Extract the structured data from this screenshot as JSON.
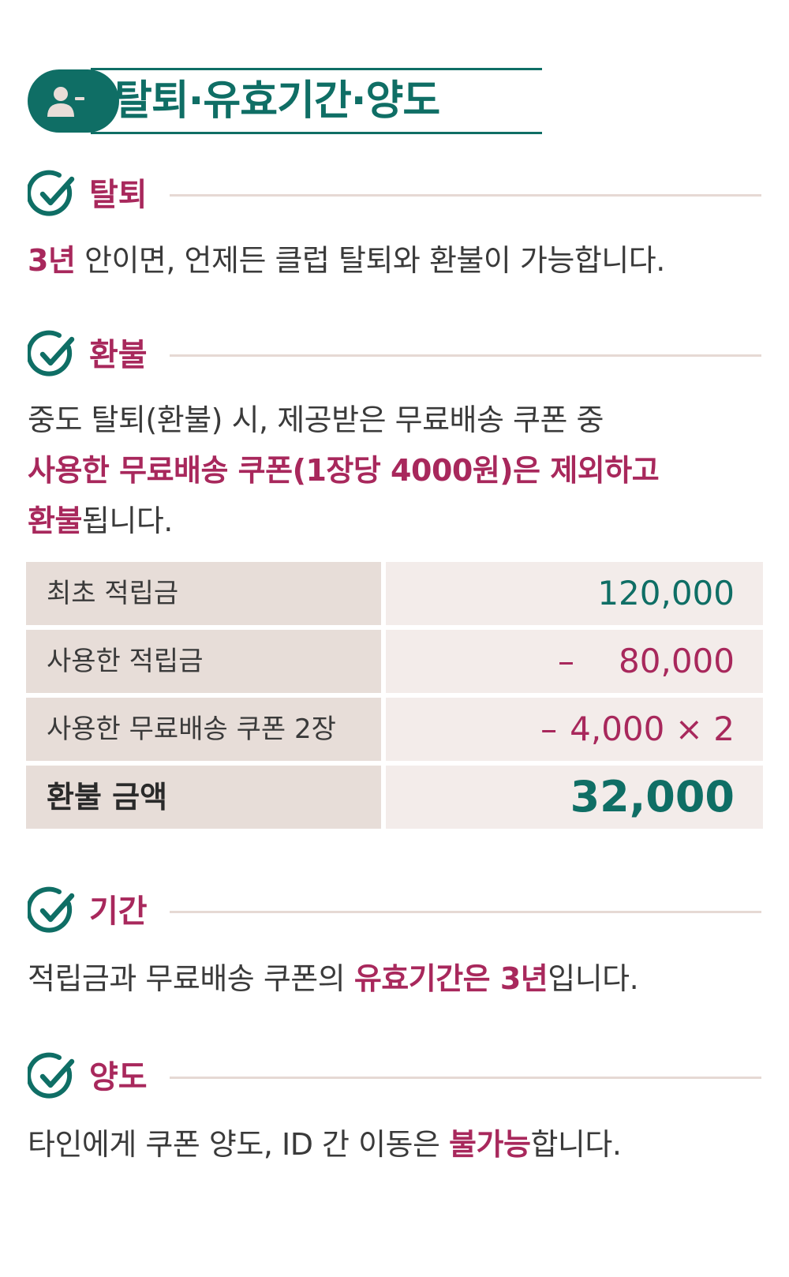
{
  "header": {
    "icon": "user-minus-icon",
    "title": "탈퇴·유효기간·양도"
  },
  "sections": {
    "withdraw": {
      "icon": "check-circle-icon",
      "heading": "탈퇴",
      "text_highlight": "3년",
      "text_rest": " 안이면, 언제든 클럽 탈퇴와 환불이 가능합니다."
    },
    "refund": {
      "icon": "check-circle-icon",
      "heading": "환불",
      "line1": "중도 탈퇴(환불) 시, 제공받은 무료배송 쿠폰 중",
      "line2_highlight": "사용한 무료배송 쿠폰(1장당 4000원)은 제외하고",
      "line3_highlight": "환불",
      "line3_rest": "됩니다."
    },
    "period": {
      "icon": "check-circle-icon",
      "heading": "기간",
      "text_start": "적립금과 무료배송 쿠폰의 ",
      "text_highlight": "유효기간은 3년",
      "text_end": "입니다."
    },
    "transfer": {
      "icon": "check-circle-icon",
      "heading": "양도",
      "text_start": "타인에게 쿠폰 양도, ID 간 이동은 ",
      "text_highlight": "불가능",
      "text_end": "합니다."
    }
  },
  "refund_table": {
    "rows": [
      {
        "label": "최초 적립금",
        "sign": "",
        "value": "120,000"
      },
      {
        "label": "사용한 적립금",
        "sign": "–",
        "value": "80,000"
      },
      {
        "label": "사용한 무료배송 쿠폰 2장",
        "sign": "–",
        "value": "4,000 × 2"
      },
      {
        "label": "환불 금액",
        "sign": "",
        "value": "32,000"
      }
    ]
  },
  "colors": {
    "teal": "#0f6e65",
    "magenta": "#a8285c",
    "label_cell": "#e7ddd8",
    "value_cell": "#f3ecea",
    "rule": "#e6d9d4"
  }
}
